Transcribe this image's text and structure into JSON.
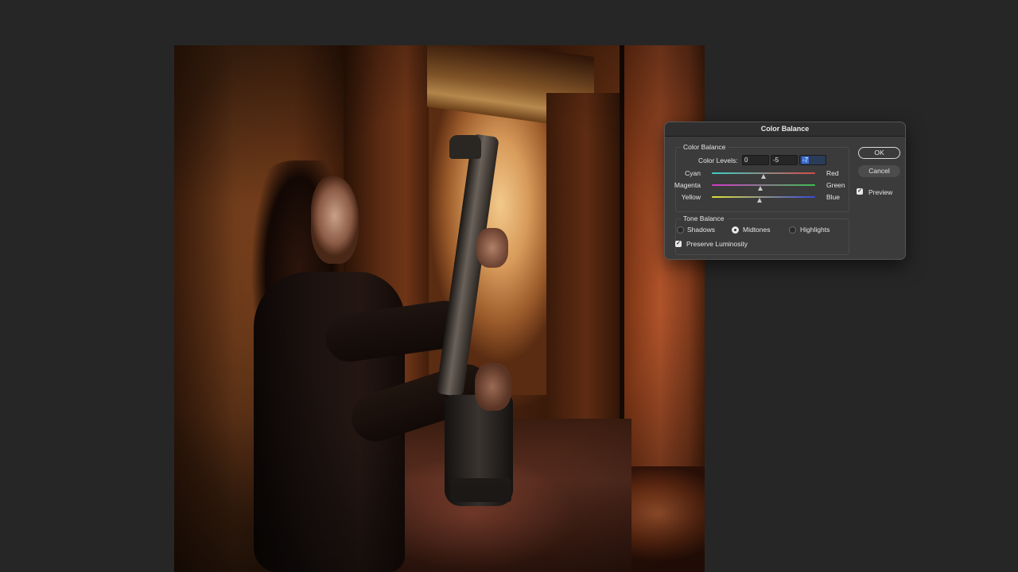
{
  "dialog": {
    "title": "Color Balance",
    "color_balance_group": {
      "legend": "Color Balance",
      "levels_label": "Color Levels:",
      "levels": [
        "0",
        "-5",
        "-7"
      ],
      "sliders": [
        {
          "left": "Cyan",
          "right": "Red",
          "value": 0
        },
        {
          "left": "Magenta",
          "right": "Green",
          "value": -5
        },
        {
          "left": "Yellow",
          "right": "Blue",
          "value": -7
        }
      ]
    },
    "tone_balance_group": {
      "legend": "Tone Balance",
      "options": [
        "Shadows",
        "Midtones",
        "Highlights"
      ],
      "selected": "Midtones",
      "preserve_luminosity_label": "Preserve Luminosity",
      "preserve_luminosity_checked": true
    },
    "buttons": {
      "ok": "OK",
      "cancel": "Cancel"
    },
    "preview_label": "Preview",
    "preview_checked": true
  },
  "colors": {
    "app_background": "#262626",
    "dialog_background": "#3b3b3b",
    "selection_highlight": "#3d6fd0"
  }
}
